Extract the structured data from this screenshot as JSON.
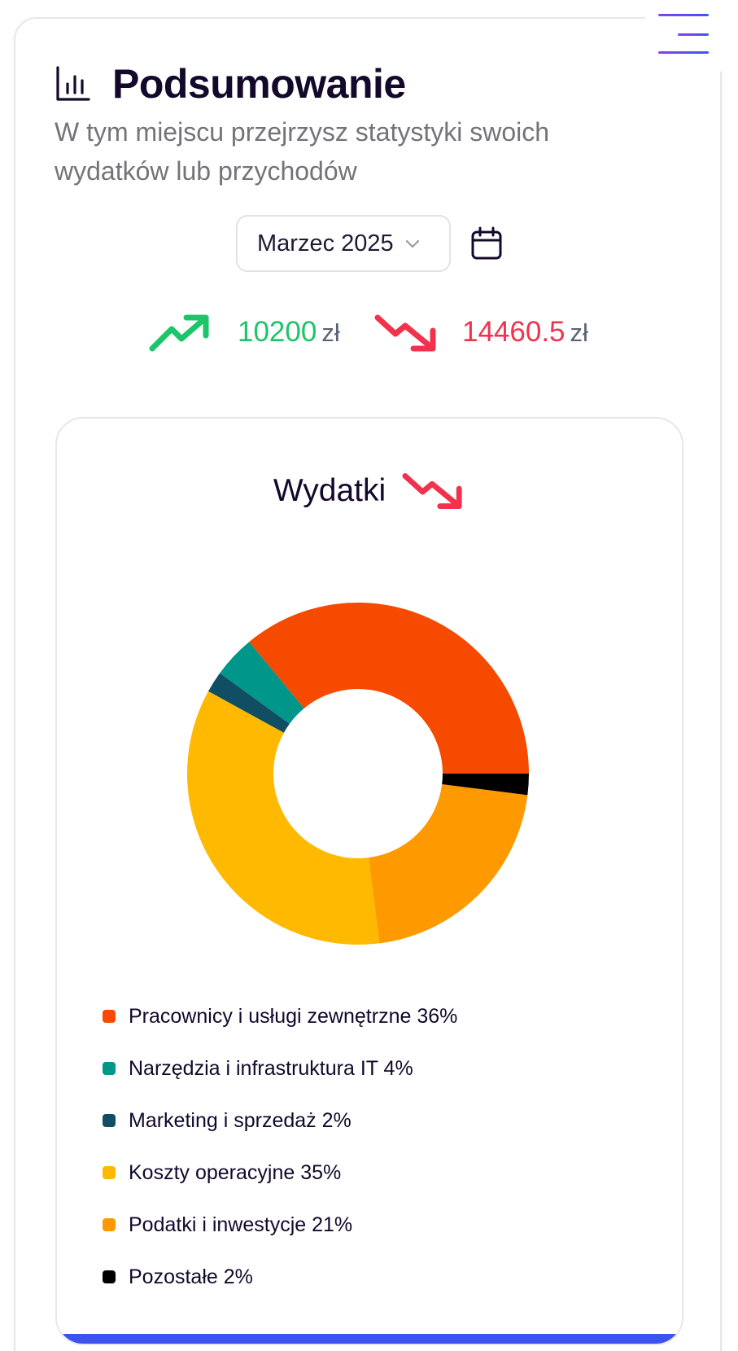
{
  "header": {
    "title": "Podsumowanie",
    "title_icon": "bar-chart-icon",
    "subtitle": "W tym miejscu przejrzysz statystyki swoich wydatków lub przychodów",
    "menu_icon": "hamburger-menu-icon"
  },
  "period": {
    "selected": "Marzec 2025",
    "dropdown_icon": "chevron-down-icon",
    "calendar_icon": "calendar-icon"
  },
  "stats": {
    "income_value": "10200",
    "income_currency": "zł",
    "income_icon": "trending-up-icon",
    "expense_value": "14460.5",
    "expense_currency": "zł",
    "expense_icon": "trending-down-icon"
  },
  "colors": {
    "income": "#1cc46a",
    "expense": "#f2324d",
    "accent": "#3d53f0"
  },
  "chart_data": {
    "type": "pie",
    "title": "Wydatki",
    "donut": true,
    "legend_position": "bottom",
    "slices": [
      {
        "label": "Pracownicy i usługi zewnętrzne",
        "value": 36,
        "display": "Pracownicy i usługi zewnętrzne 36%",
        "color": "#f54a00"
      },
      {
        "label": "Narzędzia i infrastruktura IT",
        "value": 4,
        "display": "Narzędzia i infrastruktura IT 4%",
        "color": "#009689"
      },
      {
        "label": "Marketing i sprzedaż",
        "value": 2,
        "display": "Marketing i sprzedaż 2%",
        "color": "#104e64"
      },
      {
        "label": "Koszty operacyjne",
        "value": 35,
        "display": "Koszty operacyjne 35%",
        "color": "#ffb900"
      },
      {
        "label": "Podatki i inwestycje",
        "value": 21,
        "display": "Podatki i inwestycje 21%",
        "color": "#fe9a00"
      },
      {
        "label": "Pozostałe",
        "value": 2,
        "display": "Pozostałe 2%",
        "color": "#000000"
      }
    ]
  }
}
